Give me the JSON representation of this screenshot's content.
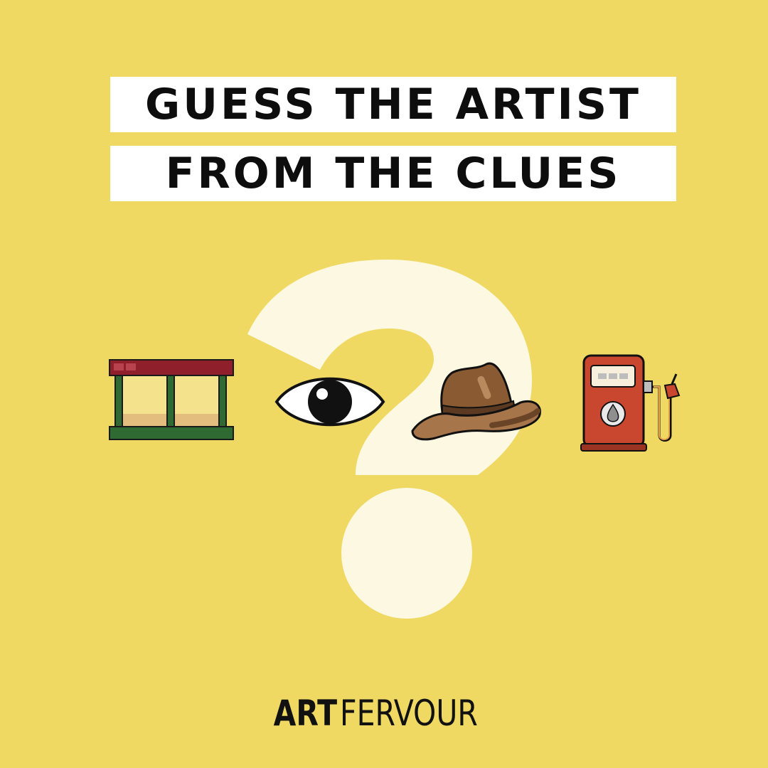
{
  "title": {
    "line1": "GUESS THE ARTIST",
    "line2": "FROM THE CLUES"
  },
  "clues": [
    {
      "icon": "storefront-icon"
    },
    {
      "icon": "eye-icon"
    },
    {
      "icon": "cowboy-hat-icon"
    },
    {
      "icon": "fuel-pump-icon"
    }
  ],
  "background_icon": "question-mark-icon",
  "brand": {
    "bold": "ART",
    "light": "FERVOUR"
  },
  "colors": {
    "background": "#EFD962",
    "question_mark": "#FDF8E1",
    "title_band": "#FFFFFF",
    "text": "#0D0D0D"
  }
}
